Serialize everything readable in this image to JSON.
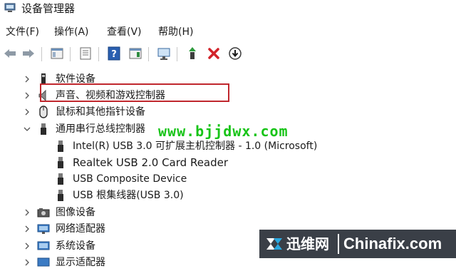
{
  "window": {
    "title": "设备管理器"
  },
  "menu": [
    {
      "label": "文件(F)"
    },
    {
      "label": "操作(A)"
    },
    {
      "label": "查看(V)"
    },
    {
      "label": "帮助(H)"
    }
  ],
  "tree": [
    {
      "label": "软件设备",
      "expanded": false,
      "icon": "software-device-icon"
    },
    {
      "label": "声音、视频和游戏控制器",
      "expanded": false,
      "icon": "speaker-icon"
    },
    {
      "label": "鼠标和其他指针设备",
      "expanded": false,
      "icon": "mouse-icon"
    },
    {
      "label": "通用串行总线控制器",
      "expanded": true,
      "icon": "usb-icon",
      "children": [
        {
          "label": "Intel(R) USB 3.0 可扩展主机控制器 - 1.0 (Microsoft)"
        },
        {
          "label": "Realtek USB 2.0 Card Reader",
          "highlighted": true
        },
        {
          "label": "USB Composite Device"
        },
        {
          "label": "USB 根集线器(USB 3.0)"
        }
      ]
    },
    {
      "label": "图像设备",
      "expanded": false,
      "icon": "camera-icon"
    },
    {
      "label": "网络适配器",
      "expanded": false,
      "icon": "network-adapter-icon"
    },
    {
      "label": "系统设备",
      "expanded": false,
      "icon": "system-device-icon"
    },
    {
      "label": "显示适配器",
      "expanded": false,
      "icon": "display-adapter-icon"
    }
  ],
  "watermarks": {
    "url": "www.bjjdwx.com",
    "brand_cn": "迅维网",
    "brand_en": "Chinafix.com"
  },
  "colors": {
    "highlight_border": "#c0272d",
    "watermark_green": "#18c418",
    "brand_band": "#3a3f47"
  }
}
